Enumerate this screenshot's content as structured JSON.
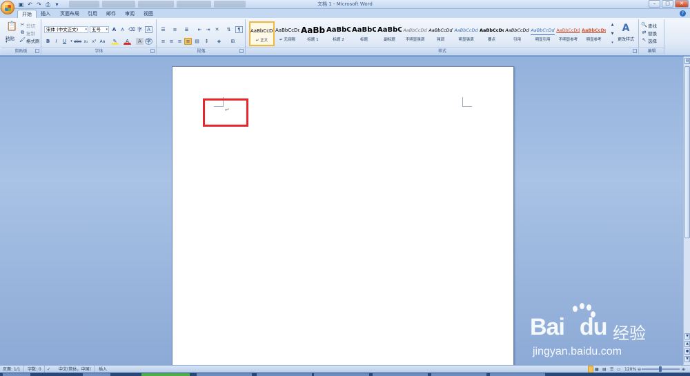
{
  "window": {
    "title": "文档 1 - Microsoft Word"
  },
  "qat": {
    "icons": [
      "save-icon",
      "undo-icon",
      "redo-icon",
      "print-icon"
    ]
  },
  "tabs": [
    "开始",
    "插入",
    "页面布局",
    "引用",
    "邮件",
    "审阅",
    "视图"
  ],
  "ribbon": {
    "clipboard": {
      "label": "剪贴板",
      "paste": "粘贴",
      "cut": "剪切",
      "copy": "复制",
      "format_painter": "格式刷"
    },
    "font": {
      "label": "字体",
      "font_name": "宋体 (中文正文)",
      "font_size": "五号",
      "bold": "B",
      "italic": "I",
      "underline": "U",
      "strike": "abe",
      "subscript": "x₂",
      "superscript": "x²",
      "case": "Aa",
      "grow": "A",
      "shrink": "A",
      "clear": "A",
      "highlight_color": "#f5e742",
      "font_color": "#e02424"
    },
    "paragraph": {
      "label": "段落"
    },
    "styles": {
      "label": "样式",
      "items": [
        {
          "sample": "AaBbCcDd",
          "name": "↵ 正文"
        },
        {
          "sample": "AaBbCcDd",
          "name": "↵ 无间隔"
        },
        {
          "sample": "AaBb",
          "name": "标题 1"
        },
        {
          "sample": "AaBbC",
          "name": "标题 2"
        },
        {
          "sample": "AaBbC",
          "name": "标题"
        },
        {
          "sample": "AaBbC",
          "name": "副标题"
        },
        {
          "sample": "AaBbCcDd",
          "name": "不明显强调"
        },
        {
          "sample": "AaBbCcDd",
          "name": "强调"
        },
        {
          "sample": "AaBbCcDd",
          "name": "明显强调"
        },
        {
          "sample": "AaBbCcDd",
          "name": "要点"
        },
        {
          "sample": "AaBbCcDd",
          "name": "引用"
        },
        {
          "sample": "AaBbCcDd",
          "name": "明显引用"
        },
        {
          "sample": "AaBbCcDd",
          "name": "不明显参考"
        },
        {
          "sample": "AaBbCcDd",
          "name": "明显参考"
        }
      ],
      "change_styles": "更改样式"
    },
    "editing": {
      "label": "编辑",
      "find": "查找",
      "replace": "替换",
      "select": "选择"
    }
  },
  "document": {
    "paragraph_mark": "↵"
  },
  "statusbar": {
    "page": "页面: 1/1",
    "words": "字数: 0",
    "language": "中文(简体，中国)",
    "mode": "插入",
    "zoom": "120%"
  },
  "watermark": {
    "brand": "Bai",
    "brand2": "du",
    "cn": "经验",
    "url": "jingyan.baidu.com"
  },
  "colors": {
    "highlight_box": "#e8252b",
    "selected_style_border": "#f2b63a"
  }
}
